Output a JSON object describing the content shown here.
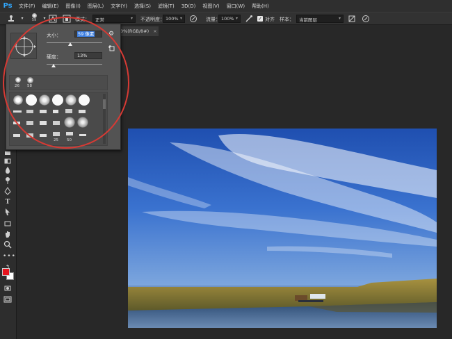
{
  "app": {
    "logo": "Ps"
  },
  "menu": {
    "items": [
      "文件(F)",
      "编辑(E)",
      "图像(I)",
      "图层(L)",
      "文字(Y)",
      "选择(S)",
      "滤镜(T)",
      "3D(D)",
      "视图(V)",
      "窗口(W)",
      "帮助(H)"
    ]
  },
  "options": {
    "brush_size_preview": "59",
    "mode_label": "模式：",
    "mode_value": "正常",
    "opacity_label": "不透明度：",
    "opacity_value": "100%",
    "flow_label": "流量：",
    "flow_value": "100%",
    "align_label": "对齐",
    "align_checked": true,
    "sample_label": "样本：",
    "sample_value": "当前图层"
  },
  "document": {
    "tab_label": "0%(RGB/8#)",
    "close_glyph": "×"
  },
  "brush_picker": {
    "size_label": "大小：",
    "size_value": "59 像素",
    "hardness_label": "硬度：",
    "hardness_value": "13%",
    "size_slider_fraction": 0.43,
    "hardness_slider_fraction": 0.13,
    "recent_tips": [
      "26",
      "58"
    ],
    "grid_labels": [
      "25",
      "50"
    ]
  },
  "colors": {
    "foreground": "#e6141e",
    "background": "#ffffff",
    "selection": "#3d7ee0",
    "annotation": "#d83a34"
  },
  "icons": {
    "stamp": "stamp-icon",
    "gear": "gear-icon",
    "new_preset": "new-preset-icon"
  }
}
